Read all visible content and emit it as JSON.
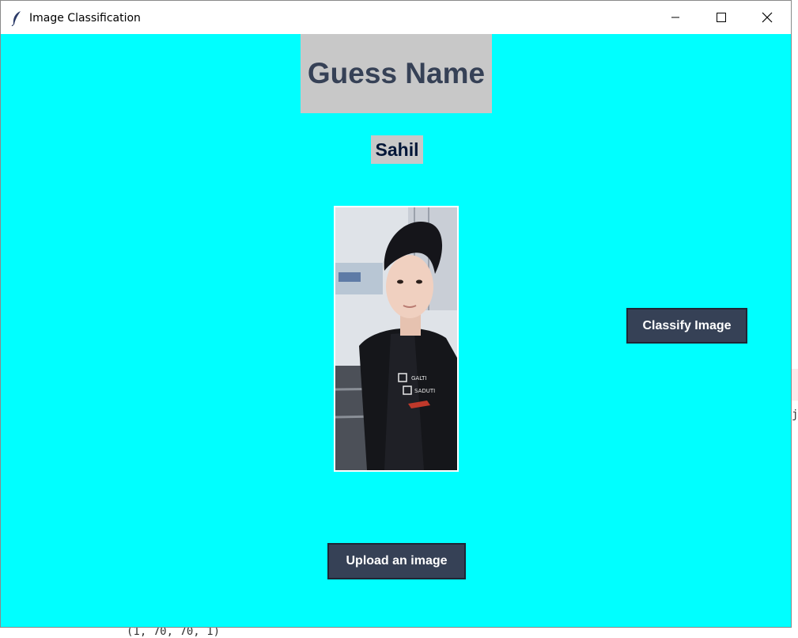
{
  "window": {
    "title": "Image Classification"
  },
  "heading": {
    "text": "Guess Name"
  },
  "result": {
    "text": "Sahil"
  },
  "buttons": {
    "classify_label": "Classify Image",
    "upload_label": "Upload an image"
  },
  "background_window": {
    "right_char": "j",
    "bottom_text": "(1, 70, 70, 1)"
  },
  "colors": {
    "background": "#00ffff",
    "heading_bg": "#c8c8c8",
    "heading_text": "#364156",
    "result_text": "#011638",
    "button_bg": "#364156",
    "button_text": "#ffffff"
  }
}
